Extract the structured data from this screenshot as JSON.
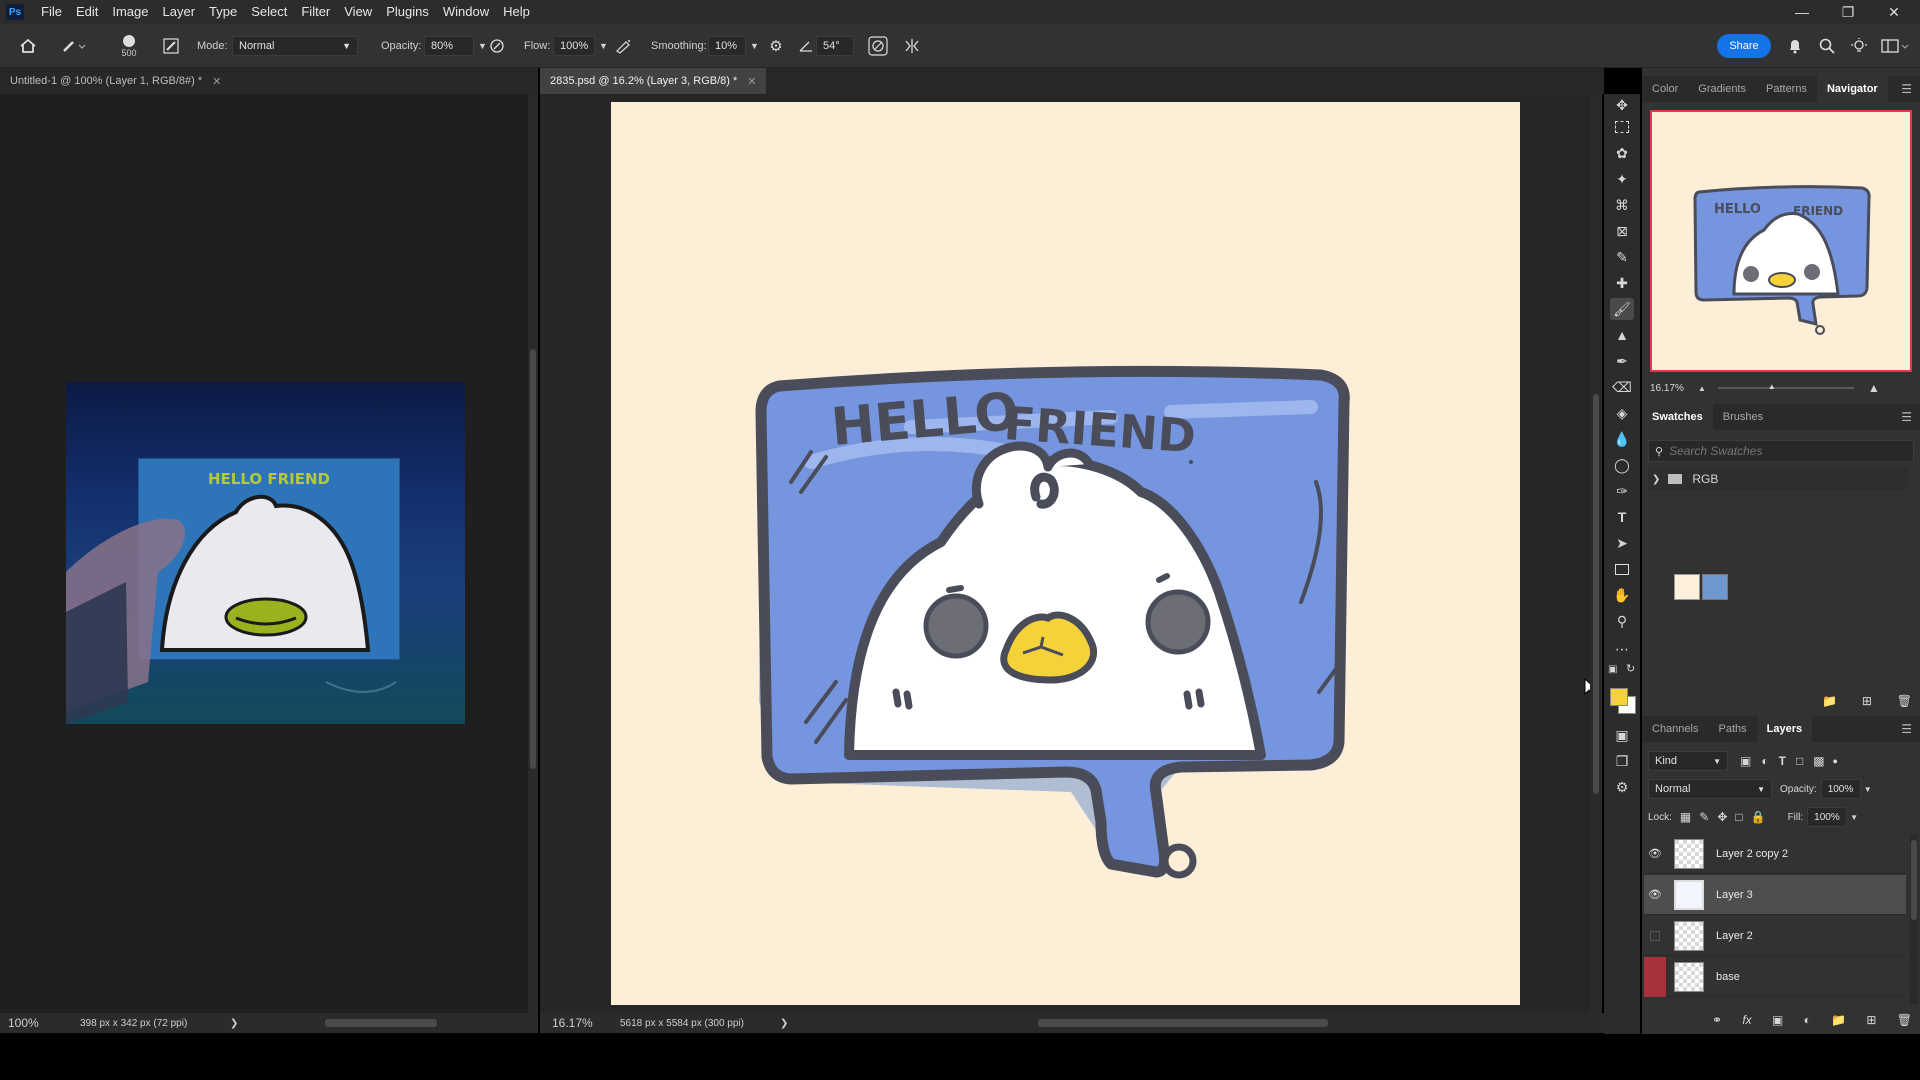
{
  "menu": {
    "app_badge": "Ps",
    "items": [
      "File",
      "Edit",
      "Image",
      "Layer",
      "Type",
      "Select",
      "Filter",
      "View",
      "Plugins",
      "Window",
      "Help"
    ]
  },
  "options_bar": {
    "brush_size": "500",
    "mode_label": "Mode:",
    "mode_value": "Normal",
    "opacity_label": "Opacity:",
    "opacity_value": "80%",
    "flow_label": "Flow:",
    "flow_value": "100%",
    "smoothing_label": "Smoothing:",
    "smoothing_value": "10%",
    "angle_value": "54°",
    "share_label": "Share"
  },
  "documents": {
    "left": {
      "tab_title": "Untitled-1 @ 100% (Layer 1, RGB/8#) *",
      "zoom": "100%",
      "info": "398 px x 342 px (72 ppi)",
      "photo_text": "HELLO FRIEND"
    },
    "right": {
      "tab_title": "2835.psd @ 16.2% (Layer 3, RGB/8) *",
      "zoom": "16.17%",
      "info": "5618 px x 5584 px (300 ppi)",
      "art_text_1": "HELLO",
      "art_text_2": "FRIEND"
    }
  },
  "panels": {
    "top_tabs": [
      "Color",
      "Gradients",
      "Patterns",
      "Navigator"
    ],
    "top_active": "Navigator",
    "navigator_zoom": "16.17%",
    "swatch_tabs": [
      "Swatches",
      "Brushes"
    ],
    "swatch_search_placeholder": "Search Swatches",
    "swatch_group": "RGB",
    "swatch_colors": [
      "#fdf0dc",
      "#6f98d0"
    ],
    "layer_tabs": [
      "Channels",
      "Paths",
      "Layers"
    ],
    "layer_filter": "Kind",
    "blend_mode": "Normal",
    "opacity_label": "Opacity:",
    "opacity_value": "100%",
    "lock_label": "Lock:",
    "fill_label": "Fill:",
    "fill_value": "100%",
    "layers": [
      {
        "name": "Layer 2 copy 2",
        "visible": true,
        "selected": false
      },
      {
        "name": "Layer 3",
        "visible": true,
        "selected": true
      },
      {
        "name": "Layer 2",
        "visible": false,
        "selected": false
      },
      {
        "name": "base",
        "visible": false,
        "selected": false
      }
    ]
  },
  "colors": {
    "foreground": "#f6d23a",
    "background": "#ffffff",
    "canvas": "#fdeed8",
    "accent": "#1473e6"
  }
}
